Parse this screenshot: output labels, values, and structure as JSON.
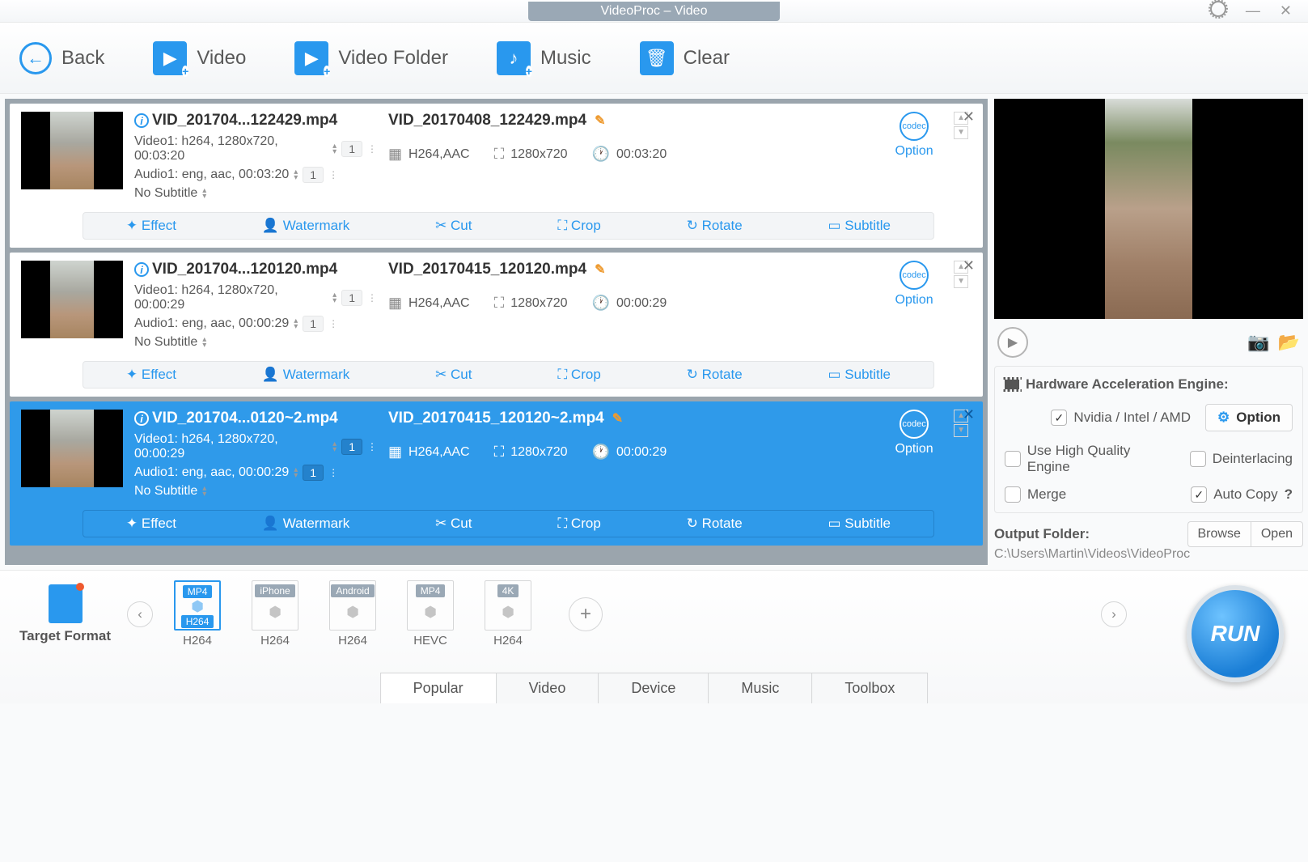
{
  "window_title": "VideoProc – Video",
  "toolbar": {
    "back": "Back",
    "video": "Video",
    "folder": "Video Folder",
    "music": "Music",
    "clear": "Clear"
  },
  "videos": [
    {
      "fname": "VID_201704...122429.mp4",
      "video_line": "Video1: h264, 1280x720, 00:03:20",
      "audio_line": "Audio1: eng, aac, 00:03:20",
      "subtitle": "No Subtitle",
      "badge": "1",
      "out_name": "VID_20170408_122429.mp4",
      "codec": "H264,AAC",
      "res": "1280x720",
      "dur": "00:03:20",
      "selected": false
    },
    {
      "fname": "VID_201704...120120.mp4",
      "video_line": "Video1: h264, 1280x720, 00:00:29",
      "audio_line": "Audio1: eng, aac, 00:00:29",
      "subtitle": "No Subtitle",
      "badge": "1",
      "out_name": "VID_20170415_120120.mp4",
      "codec": "H264,AAC",
      "res": "1280x720",
      "dur": "00:00:29",
      "selected": false
    },
    {
      "fname": "VID_201704...0120~2.mp4",
      "video_line": "Video1: h264, 1280x720, 00:00:29",
      "audio_line": "Audio1: eng, aac, 00:00:29",
      "subtitle": "No Subtitle",
      "badge": "1",
      "out_name": "VID_20170415_120120~2.mp4",
      "codec": "H264,AAC",
      "res": "1280x720",
      "dur": "00:00:29",
      "selected": true
    }
  ],
  "actions": {
    "effect": "Effect",
    "watermark": "Watermark",
    "cut": "Cut",
    "crop": "Crop",
    "rotate": "Rotate",
    "subtitle": "Subtitle",
    "option": "Option"
  },
  "hardware": {
    "title": "Hardware Acceleration Engine:",
    "nvidia": "Nvidia / Intel / AMD",
    "option_btn": "Option",
    "hq": "Use High Quality Engine",
    "deinterlace": "Deinterlacing",
    "merge": "Merge",
    "autocopy": "Auto Copy",
    "help": "?"
  },
  "output": {
    "label": "Output Folder:",
    "browse": "Browse",
    "open": "Open",
    "path": "C:\\Users\\Martin\\Videos\\VideoProc"
  },
  "target": {
    "label": "Target Format",
    "formats": [
      {
        "top": "MP4",
        "bot": "H264",
        "cap": "H264",
        "selected": true
      },
      {
        "top": "iPhone",
        "bot": "",
        "cap": "H264",
        "selected": false
      },
      {
        "top": "Android",
        "bot": "",
        "cap": "H264",
        "selected": false
      },
      {
        "top": "MP4",
        "bot": "",
        "cap": "HEVC",
        "selected": false
      },
      {
        "top": "4K",
        "bot": "",
        "cap": "H264",
        "selected": false
      }
    ]
  },
  "tabs": [
    "Popular",
    "Video",
    "Device",
    "Music",
    "Toolbox"
  ],
  "active_tab": "Popular",
  "run": "RUN"
}
